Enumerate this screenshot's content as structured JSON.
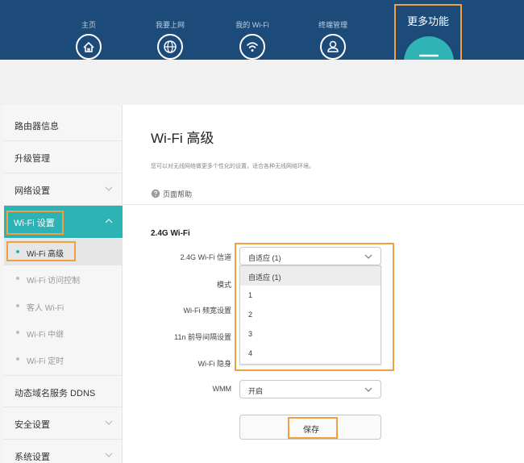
{
  "nav": {
    "items": [
      {
        "label": "主页",
        "icon": "home-icon"
      },
      {
        "label": "我要上网",
        "icon": "globe-icon"
      },
      {
        "label": "我的 Wi-Fi",
        "icon": "wifi-icon"
      },
      {
        "label": "终端管理",
        "icon": "user-icon"
      }
    ],
    "more": {
      "label": "更多功能",
      "icon": "hamburger-menu-icon"
    }
  },
  "sidebar": {
    "items": [
      {
        "label": "路由器信息"
      },
      {
        "label": "升级管理"
      },
      {
        "label": "网络设置",
        "icon": "chevron-down-icon"
      },
      {
        "label": "Wi-Fi 设置",
        "icon": "chevron-up-icon",
        "active": true
      },
      {
        "label": "动态域名服务 DDNS"
      },
      {
        "label": "安全设置",
        "icon": "chevron-down-icon"
      },
      {
        "label": "系统设置",
        "icon": "chevron-down-icon"
      }
    ],
    "subitems": [
      {
        "label": "Wi-Fi 高级",
        "active": true
      },
      {
        "label": "Wi-Fi 访问控制"
      },
      {
        "label": "客人 Wi-Fi"
      },
      {
        "label": "Wi-Fi 中继"
      },
      {
        "label": "Wi-Fi 定时"
      }
    ]
  },
  "main": {
    "title": "Wi-Fi 高级",
    "description": "您可以对无线网络做更多个性化的设置，适合各种无线网络环境。",
    "help_link": "页面帮助",
    "section_title": "2.4G Wi-Fi",
    "fields": {
      "channel": {
        "label": "2.4G Wi-Fi 信道",
        "value": "自适应 (1)"
      },
      "mode": {
        "label": "模式"
      },
      "bandwidth": {
        "label": "Wi-Fi 频宽设置"
      },
      "guard_interval": {
        "label": "11n 前导间隔设置"
      },
      "hide": {
        "label": "Wi-Fi 隐身"
      },
      "wmm": {
        "label": "WMM",
        "value": "开启"
      }
    },
    "channel_options": [
      "自适应 (1)",
      "1",
      "2",
      "3",
      "4"
    ],
    "save_label": "保存"
  },
  "colors": {
    "header": "#1d4b79",
    "accent": "#2db2b5",
    "highlight": "#f0a040"
  }
}
